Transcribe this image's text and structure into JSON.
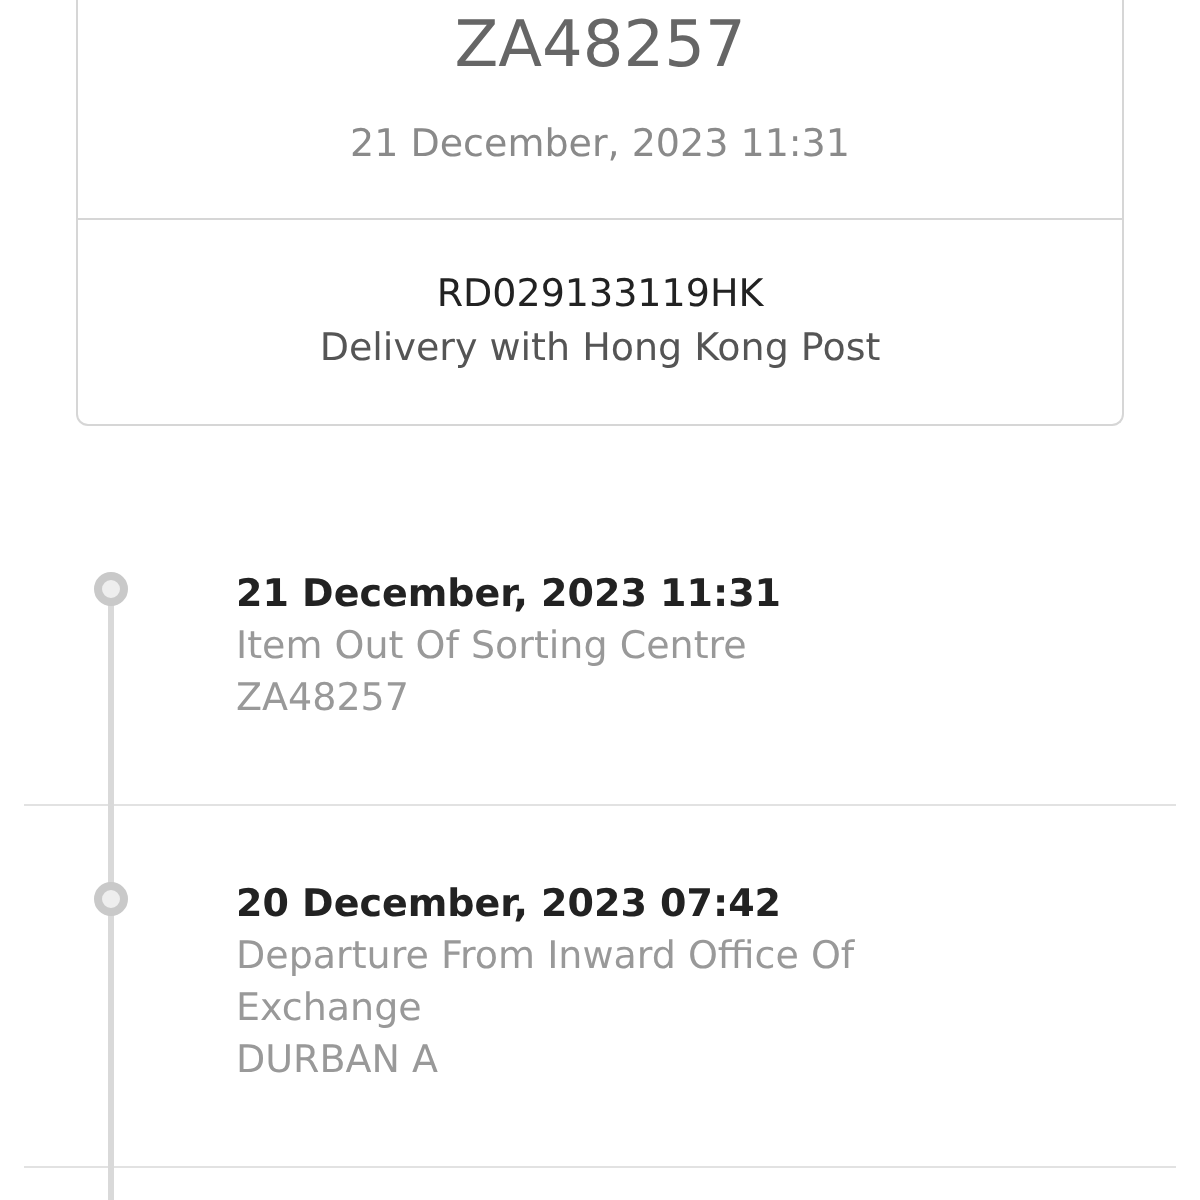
{
  "package": {
    "tracking_code": "ZA48257",
    "date": "21 December, 2023 11:31"
  },
  "shipment": {
    "number": "RD029133119HK",
    "carrier": "Delivery with Hong Kong Post"
  },
  "events": [
    {
      "date": "21 December, 2023 11:31",
      "status": "Item Out Of Sorting Centre",
      "location": "ZA48257"
    },
    {
      "date": "20 December, 2023 07:42",
      "status": "Departure From Inward Office Of Exchange",
      "location": "DURBAN A"
    }
  ]
}
